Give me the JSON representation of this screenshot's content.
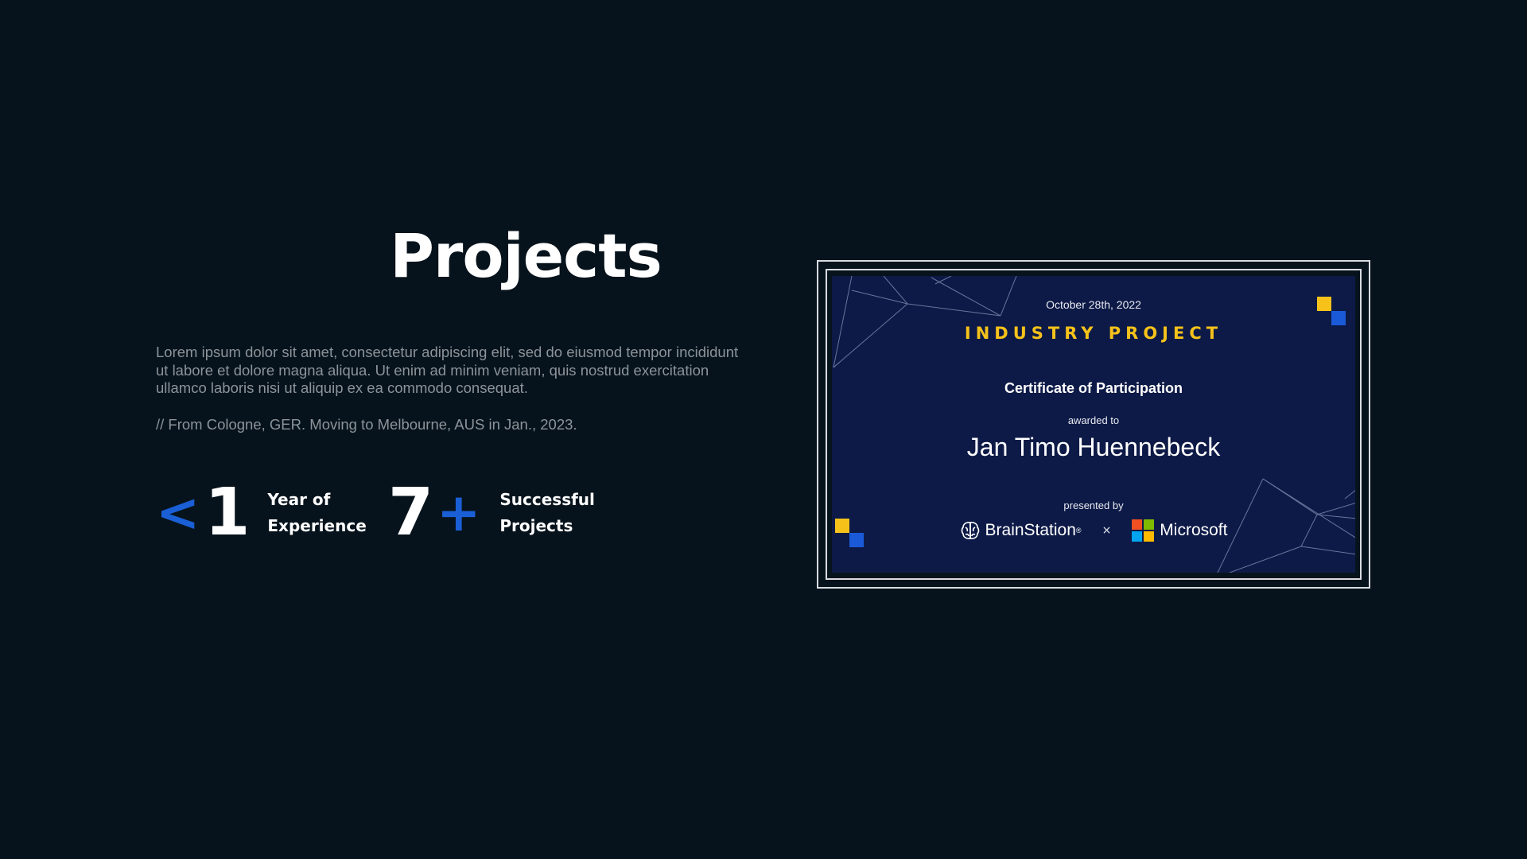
{
  "hero": {
    "title": "Projects",
    "description": "Lorem ipsum dolor sit amet, consectetur adipiscing elit, sed do eiusmod tempor incididunt ut labore et dolore magna aliqua. Ut enim ad minim veniam, quis nostrud exercitation ullamco laboris nisi ut aliquip ex ea commodo consequat.",
    "origin": "// From Cologne, GER. Moving to Melbourne, AUS in Jan., 2023."
  },
  "stats": [
    {
      "prefix": "<",
      "number": "1",
      "suffix": "",
      "label_line1": "Year of",
      "label_line2": "Experience"
    },
    {
      "prefix": "",
      "number": "7",
      "suffix": "+",
      "label_line1": "Successful",
      "label_line2": "Projects"
    }
  ],
  "certificate": {
    "date": "October 28th, 2022",
    "heading": "INDUSTRY PROJECT",
    "subtitle": "Certificate of Participation",
    "awarded_to": "awarded to",
    "recipient": "Jan Timo Huennebeck",
    "presented_by": "presented by",
    "partner_1": "BrainStation",
    "partner_1_mark": "®",
    "separator": "×",
    "partner_2": "Microsoft"
  },
  "colors": {
    "background": "#07131c",
    "accent_blue": "#1a5fd6",
    "certificate_navy": "#0d1a47",
    "certificate_yellow": "#f6c21a",
    "body_text_gray": "#8c939a",
    "ms_red": "#f25022",
    "ms_green": "#7fba00",
    "ms_blue": "#00a4ef",
    "ms_yellow": "#ffb900"
  },
  "icons": {
    "partner_1_logo": "brain-icon",
    "partner_2_logo": "windows-grid-icon"
  }
}
